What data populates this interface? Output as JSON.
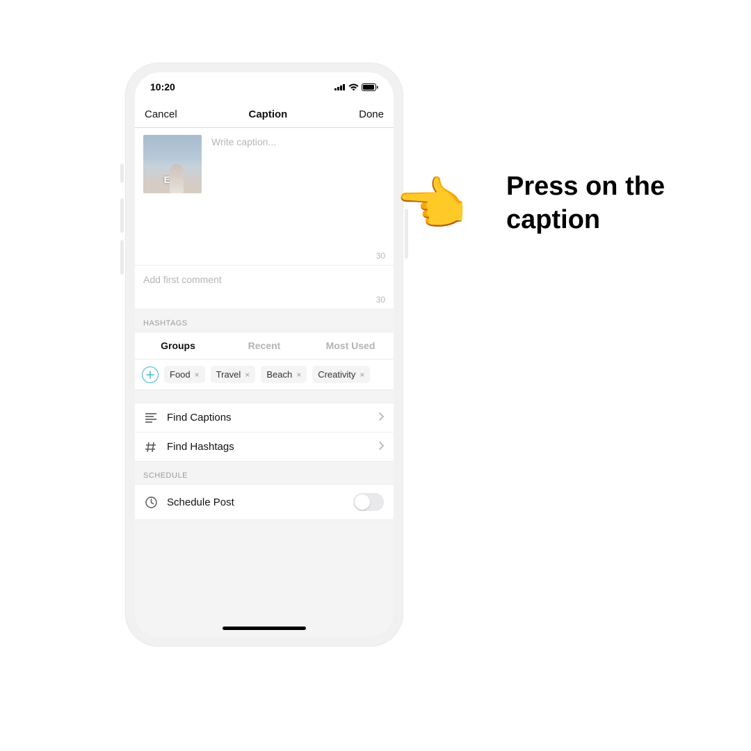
{
  "instruction": "Press on the caption",
  "status": {
    "time": "10:20"
  },
  "nav": {
    "cancel": "Cancel",
    "title": "Caption",
    "done": "Done"
  },
  "caption": {
    "placeholder": "Write caption...",
    "thumbEdit": "Edit",
    "counter": "30"
  },
  "comment": {
    "placeholder": "Add first comment",
    "counter": "30"
  },
  "hashtags": {
    "sectionLabel": "HASHTAGS",
    "tabs": {
      "groups": "Groups",
      "recent": "Recent",
      "mostUsed": "Most Used"
    },
    "chips": [
      "Food",
      "Travel",
      "Beach",
      "Creativity"
    ]
  },
  "actions": {
    "findCaptions": "Find Captions",
    "findHashtags": "Find Hashtags"
  },
  "schedule": {
    "sectionLabel": "SCHEDULE",
    "row": "Schedule Post"
  }
}
